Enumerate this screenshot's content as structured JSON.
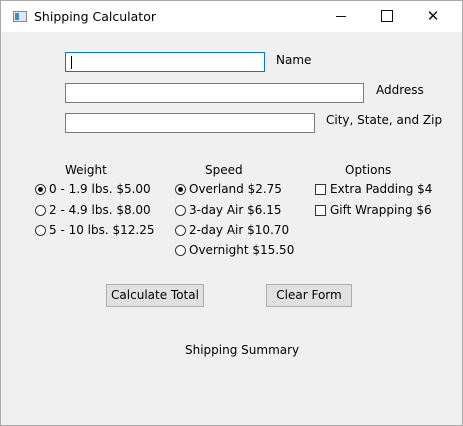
{
  "window": {
    "title": "Shipping Calculator"
  },
  "fields": {
    "name": {
      "label": "Name",
      "value": ""
    },
    "address": {
      "label": "Address",
      "value": ""
    },
    "city": {
      "label": "City, State, and Zip",
      "value": ""
    }
  },
  "weight": {
    "header": "Weight",
    "options": [
      {
        "label": "0 - 1.9 lbs. $5.00",
        "checked": true
      },
      {
        "label": "2 - 4.9 lbs. $8.00",
        "checked": false
      },
      {
        "label": "5 - 10 lbs. $12.25",
        "checked": false
      }
    ]
  },
  "speed": {
    "header": "Speed",
    "options": [
      {
        "label": "Overland $2.75",
        "checked": true
      },
      {
        "label": "3-day Air $6.15",
        "checked": false
      },
      {
        "label": "2-day Air $10.70",
        "checked": false
      },
      {
        "label": "Overnight $15.50",
        "checked": false
      }
    ]
  },
  "options": {
    "header": "Options",
    "items": [
      {
        "label": "Extra Padding $4",
        "checked": false
      },
      {
        "label": "Gift Wrapping $6",
        "checked": false
      }
    ]
  },
  "buttons": {
    "calculate": "Calculate Total",
    "clear": "Clear Form"
  },
  "summary": {
    "label": "Shipping Summary"
  }
}
